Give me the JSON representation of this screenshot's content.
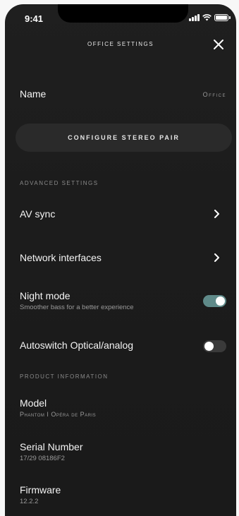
{
  "status_bar": {
    "time": "9:41"
  },
  "header": {
    "title": "OFFICE SETTINGS"
  },
  "name_row": {
    "label": "Name",
    "value": "Office"
  },
  "stereo_button": {
    "label": "CONFIGURE STEREO PAIR"
  },
  "advanced": {
    "heading": "ADVANCED SETTINGS",
    "av_sync": {
      "label": "AV sync"
    },
    "network": {
      "label": "Network interfaces"
    },
    "night_mode": {
      "label": "Night mode",
      "subtitle": "Smoother bass for a better experience",
      "enabled": true
    },
    "autoswitch": {
      "label": "Autoswitch Optical/analog",
      "enabled": false
    }
  },
  "product": {
    "heading": "PRODUCT INFORMATION",
    "model": {
      "label": "Model",
      "value": "Phantom I Opéra de Paris"
    },
    "serial": {
      "label": "Serial Number",
      "value": "17/29 08186F2"
    },
    "firmware": {
      "label": "Firmware",
      "value": "12.2.2"
    }
  },
  "colors": {
    "background": "#1c1c1c",
    "toggle_on": "#5f8a89",
    "toggle_off": "#3a3a3a",
    "pill": "#2a2a2a"
  }
}
